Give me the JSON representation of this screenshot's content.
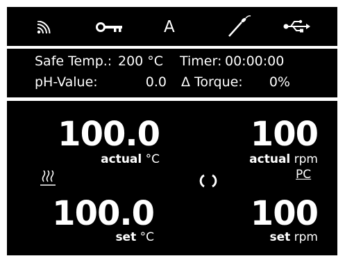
{
  "top_bar": {
    "icons": [
      "wifi-icon",
      "key-icon",
      "mode-icon",
      "temperature-probe-icon",
      "usb-icon"
    ],
    "mode_letter": "A"
  },
  "info": {
    "safe_temp_label": "Safe Temp.:",
    "safe_temp_value": "200 °C",
    "timer_label": "Timer:",
    "timer_value": "00:00:00",
    "ph_label": "pH-Value:",
    "ph_value": "0.0",
    "torque_label": "Δ Torque:",
    "torque_value": "0%"
  },
  "temperature": {
    "actual_value": "100.0",
    "actual_label": "actual",
    "actual_unit": "°C",
    "set_value": "100.0",
    "set_label": "set",
    "set_unit": "°C"
  },
  "speed": {
    "actual_value": "100",
    "actual_label": "actual",
    "actual_unit": "rpm",
    "set_value": "100",
    "set_label": "set",
    "set_unit": "rpm",
    "mode_label": "PC"
  },
  "colors": {
    "background": "#000000",
    "foreground": "#ffffff",
    "frame": "#ffffff"
  }
}
